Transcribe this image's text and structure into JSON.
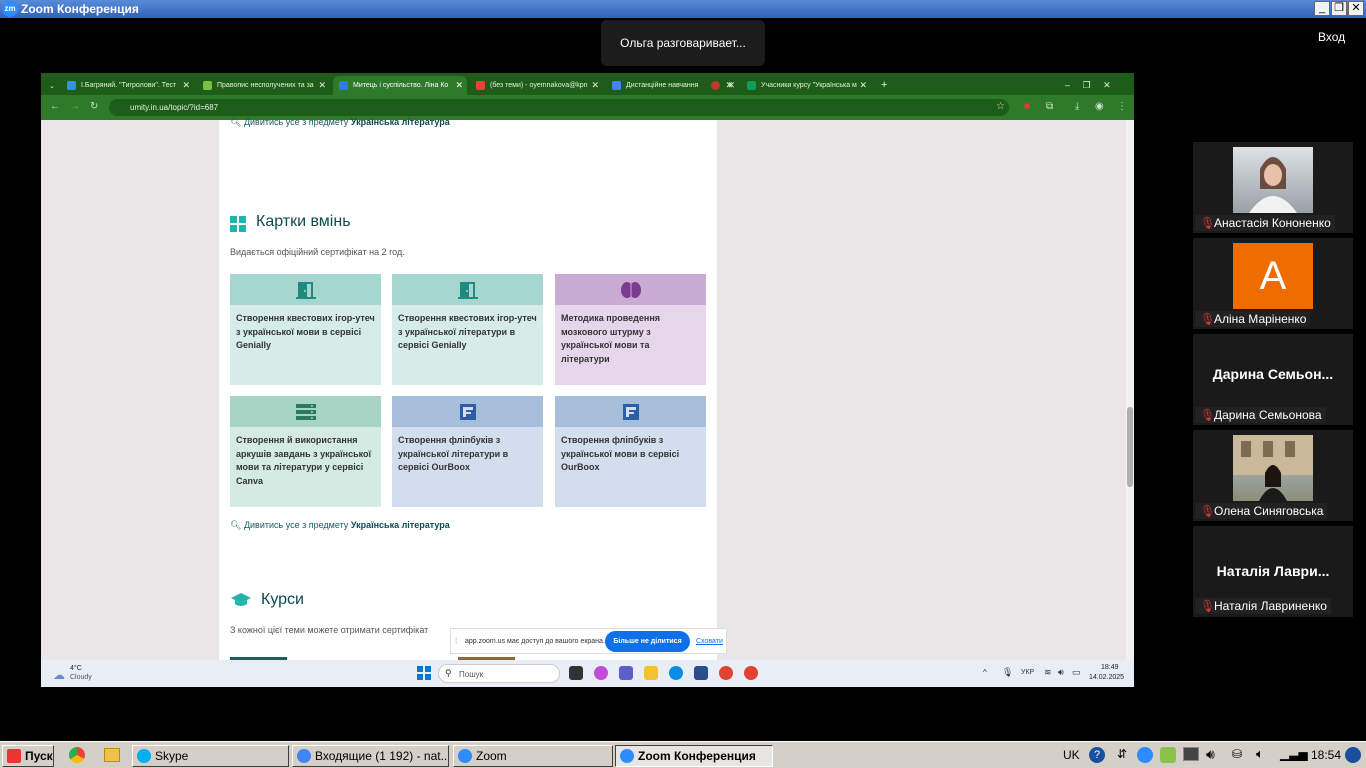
{
  "zoom_window": {
    "title": "Zoom Конференция",
    "speaker_status": "Ольга разговаривает...",
    "exit_label": "Вход"
  },
  "browser": {
    "tabs": [
      {
        "label": "І.Багряний. \"Тигролови\". Тест",
        "color": "#3a8ee6"
      },
      {
        "label": "Правопис несполучених та за",
        "color": "#7bc043"
      },
      {
        "label": "Митець і суспільство. Ліна Ко",
        "color": "#2c7be5"
      },
      {
        "label": "(без теми) - oyemnakova@kpn",
        "color": "#ea4335"
      },
      {
        "label": "Дистанційне навчання",
        "color": "#4285f4"
      },
      {
        "label": "",
        "color": "#c0392b"
      },
      {
        "label": "Учасники курсу \"Українська м",
        "color": "#0f9d58"
      }
    ],
    "new_tab": "+",
    "url": "umity.in.ua/topic/?id=687"
  },
  "page": {
    "see_all_prefix": "Дивитись усе з предмету",
    "see_all_subject": "Українська література",
    "skills_section": {
      "title": "Картки вмінь",
      "subtitle": "Видається офіційний сертифікат на 2 год."
    },
    "cards": [
      {
        "text": "Створення квестових ігор-утеч з української мови в сервісі Genially",
        "icon": "door-icon",
        "top_color": "#a5d6d0",
        "bg": "#d5ece9",
        "icon_color": "#1f8a7e"
      },
      {
        "text": "Створення квестових ігор-утеч з української літератури в сервісі Genially",
        "icon": "door-icon",
        "top_color": "#a5d6d0",
        "bg": "#d5ece9",
        "icon_color": "#1f8a7e"
      },
      {
        "text": "Методика проведення мозкового штурму з української мови та літератури",
        "icon": "brain-icon",
        "top_color": "#c9abd3",
        "bg": "#e6d6eb",
        "icon_color": "#7b3c91"
      },
      {
        "text": "Створення й використання аркушів завдань з української мови та літератури у сервісі Canva",
        "icon": "server-icon",
        "top_color": "#a8d4c5",
        "bg": "#d4ebe3",
        "icon_color": "#2a7a62"
      },
      {
        "text": "Створення фліпбуків з української літератури в сервісі OurBoox",
        "icon": "flipbook-icon",
        "top_color": "#a7bedb",
        "bg": "#d2deed",
        "icon_color": "#2a5fa8"
      },
      {
        "text": "Створення фліпбуків з української мови в сервісі OurBoox",
        "icon": "flipbook-icon",
        "top_color": "#a7bedb",
        "bg": "#d2deed",
        "icon_color": "#2a5fa8"
      }
    ],
    "courses_section": {
      "title": "Курси",
      "subtitle": "З кожної цієї теми можете отримати сертифікат"
    }
  },
  "share_banner": {
    "text": "app.zoom.us має доступ до вашого екрана.",
    "stop_label": "Більше не ділитися",
    "hide_label": "Сховати"
  },
  "inner_taskbar": {
    "weather_temp": "4°C",
    "weather_desc": "Cloudy",
    "search_placeholder": "Пошук",
    "lang": "УКР",
    "time": "18:49",
    "date": "14.02.2025"
  },
  "participants": [
    {
      "name": "Анастасія Кононенко",
      "type": "video",
      "color": "#6e7276"
    },
    {
      "name": "Аліна Маріненко",
      "type": "avatar",
      "letter": "A",
      "color": "#ee6c00"
    },
    {
      "name": "Дарина Семьонова",
      "type": "text",
      "display": "Дарина  Семьон..."
    },
    {
      "name": "Олена Синяговська",
      "type": "video",
      "color": "#8a8f7a"
    },
    {
      "name": "Наталія Лавриненко",
      "type": "text",
      "display": "Наталія  Лаври..."
    }
  ],
  "taskbar": {
    "start_label": "Пуск",
    "buttons": [
      {
        "label": "Skype",
        "color": "#00aff0"
      },
      {
        "label": "Входящие (1 192) - nat...",
        "color": "#4285f4"
      },
      {
        "label": "Zoom",
        "color": "#2d8cff"
      },
      {
        "label": "Zoom Конференция",
        "color": "#2d8cff"
      }
    ],
    "lang": "UK",
    "clock": "18:54"
  }
}
